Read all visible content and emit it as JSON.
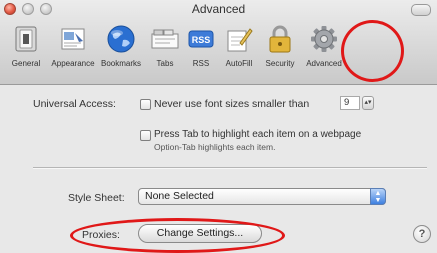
{
  "window": {
    "title": "Advanced",
    "accent_color": "#e01818"
  },
  "toolbar": {
    "items": [
      {
        "label": "General",
        "icon": "switch-icon"
      },
      {
        "label": "Appearance",
        "icon": "appearance-icon"
      },
      {
        "label": "Bookmarks",
        "icon": "globe-icon"
      },
      {
        "label": "Tabs",
        "icon": "tabs-icon"
      },
      {
        "label": "RSS",
        "icon": "rss-icon"
      },
      {
        "label": "AutoFill",
        "icon": "pencil-icon"
      },
      {
        "label": "Security",
        "icon": "lock-icon"
      },
      {
        "label": "Advanced",
        "icon": "gear-icon",
        "selected": true
      }
    ]
  },
  "advanced": {
    "universal_access_label": "Universal Access:",
    "min_font_label": "Never use font sizes smaller than",
    "min_font_value": "9",
    "tab_highlight_label": "Press Tab to highlight each item on a webpage",
    "tab_highlight_sub": "Option-Tab highlights each item.",
    "style_sheet_label": "Style Sheet:",
    "style_sheet_value": "None Selected",
    "proxies_label": "Proxies:",
    "change_settings_label": "Change Settings...",
    "help_label": "?"
  }
}
